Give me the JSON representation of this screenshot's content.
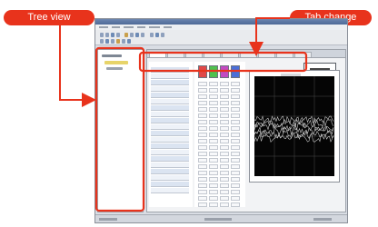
{
  "callouts": {
    "tree_view": "Tree view",
    "tab_change": "Tab change"
  },
  "colors": {
    "callout": "#e8331c",
    "tree_selection": "#e7d46a",
    "scope_background": "#050505"
  },
  "app": {
    "channel_header_colors": [
      "#e04848",
      "#4fc14f",
      "#c24bc2",
      "#4a6fd8"
    ]
  }
}
